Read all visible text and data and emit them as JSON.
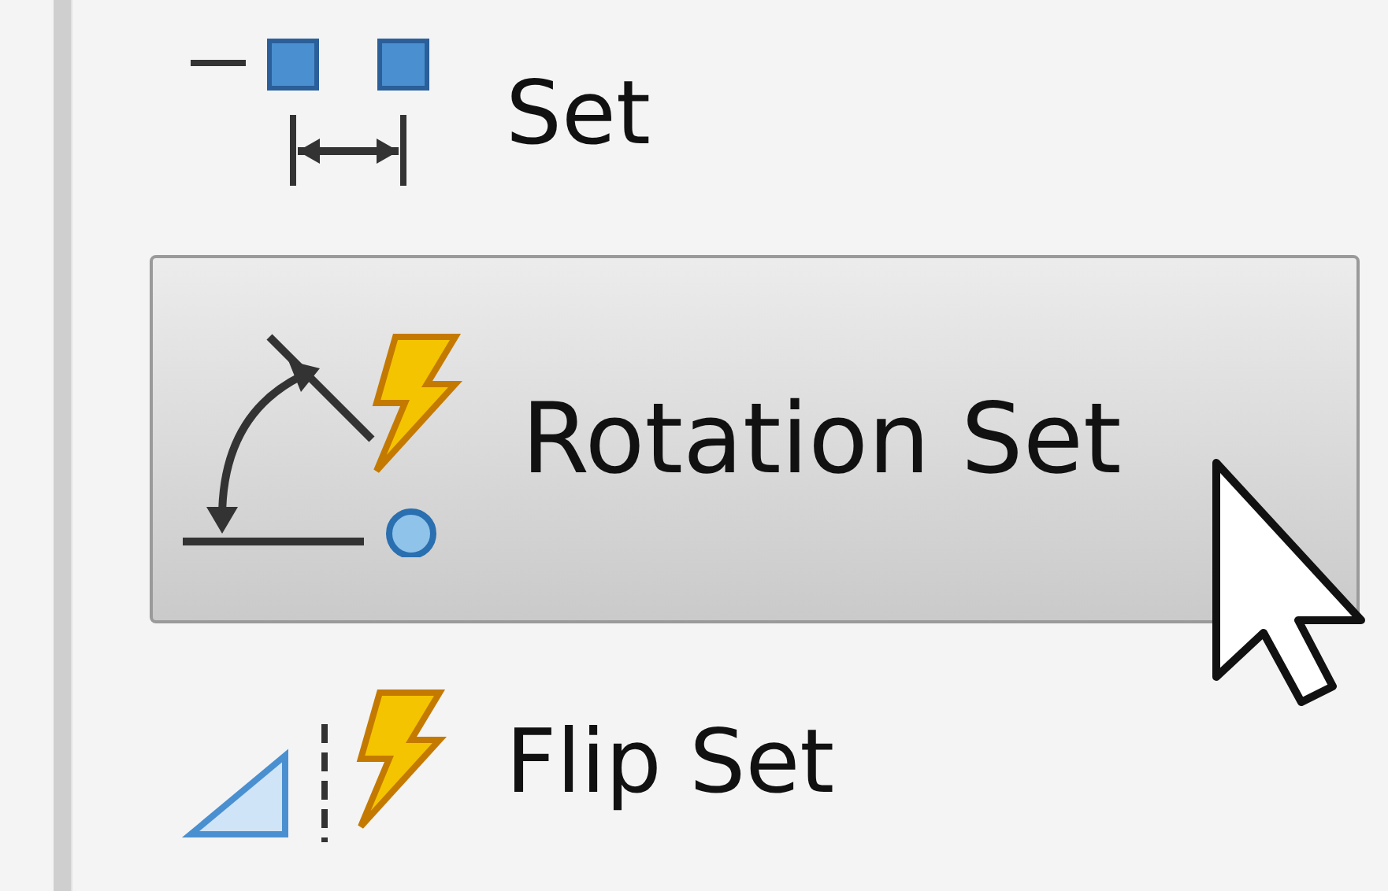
{
  "menu": {
    "items": [
      {
        "label": "Set",
        "selected": false,
        "kind": "distance"
      },
      {
        "label": "Rotation Set",
        "selected": true,
        "kind": "rotation"
      },
      {
        "label": "Flip Set",
        "selected": false,
        "kind": "flip"
      }
    ]
  }
}
